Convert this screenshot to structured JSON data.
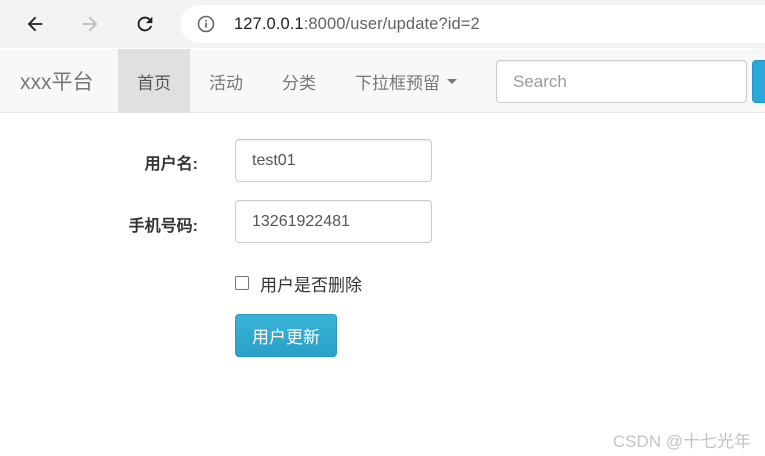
{
  "browser": {
    "url_host": "127.0.0.1",
    "url_rest": ":8000/user/update?id=2"
  },
  "navbar": {
    "brand": "xxx平台",
    "items": [
      {
        "label": "首页",
        "active": true
      },
      {
        "label": "活动",
        "active": false
      },
      {
        "label": "分类",
        "active": false
      },
      {
        "label": "下拉框预留",
        "active": false,
        "dropdown": true
      }
    ],
    "search": {
      "placeholder": "Search",
      "value": ""
    }
  },
  "form": {
    "username": {
      "label": "用户名:",
      "value": "test01"
    },
    "phone": {
      "label": "手机号码:",
      "value": "13261922481"
    },
    "deleted_checkbox": {
      "label": "用户是否删除",
      "checked": false
    },
    "submit_label": "用户更新"
  },
  "watermark": "CSDN @十七光年",
  "colors": {
    "accent": "#2aa9d8",
    "navbar_bg": "#f8f8f8",
    "active_tab_bg": "#e0e0e0"
  }
}
